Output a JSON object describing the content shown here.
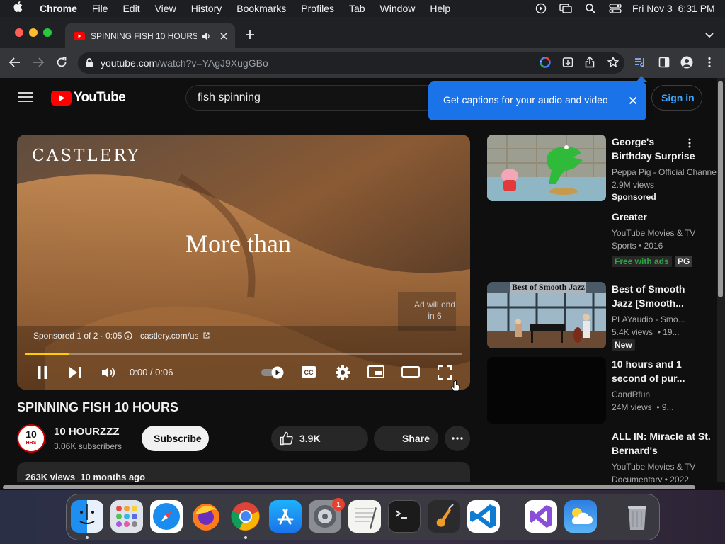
{
  "mac_menu": {
    "items": [
      "Chrome",
      "File",
      "Edit",
      "View",
      "History",
      "Bookmarks",
      "Profiles",
      "Tab",
      "Window",
      "Help"
    ],
    "datetime": "Fri Nov 3  6:31 PM"
  },
  "browser": {
    "tab_title": "SPINNING FISH 10 HOURS",
    "url_host": "youtube.com",
    "url_path": "/watch?v=YAgJ9XugGBo"
  },
  "youtube": {
    "logo_text": "YouTube",
    "search_value": "fish spinning",
    "sign_in": "Sign in",
    "caption_popup": "Get captions for your audio and video"
  },
  "player": {
    "brand": "CASTLERY",
    "overlay_text": "More than",
    "ad_end": "Ad will end in 6",
    "sponsored": "Sponsored 1 of 2 · 0:05",
    "ad_site": "castlery.com/us",
    "time": "0:00 / 0:06",
    "cc_label": "CC",
    "progress_fraction": 0.1
  },
  "video": {
    "title": "SPINNING FISH 10 HOURS",
    "channel": "10 HOURZZZ",
    "avatar_line1": "10",
    "avatar_line2": "HRS",
    "subscribers": "3.06K subscribers",
    "subscribe": "Subscribe",
    "likes": "3.9K",
    "share": "Share",
    "views_date": "263K views  10 months ago"
  },
  "recommendations": [
    {
      "title": "George's Birthday Surprise",
      "channel": "Peppa Pig - Official Channe",
      "meta": "2.9M views",
      "badge": "Sponsored"
    },
    {
      "title": "Greater",
      "channel": "YouTube Movies & TV",
      "meta": "Sports • 2016",
      "badge": "Free with ads",
      "rating": "PG"
    },
    {
      "title": "Best of Smooth Jazz [Smooth...",
      "channel": "PLAYaudio - Smo...",
      "meta": "5.4K views  • 19...",
      "badge": "New",
      "thumb_text": "Best of Smooth Jazz"
    },
    {
      "title": "10 hours and 1 second of pur...",
      "channel": "CandRfun",
      "meta": "24M views  • 9..."
    },
    {
      "title": "ALL IN: Miracle at St. Bernard's",
      "channel": "YouTube Movies & TV",
      "meta": "Documentary • 2022"
    }
  ],
  "dock": {
    "notification_count": "1",
    "apps": [
      "finder-icon",
      "launchpad-icon",
      "safari-icon",
      "firefox-icon",
      "chrome-icon",
      "app-store-icon",
      "system-settings-icon",
      "textedit-icon",
      "terminal-icon",
      "garageband-icon",
      "vscode-icon",
      "visual-studio-icon",
      "weather-icon",
      "trash-icon"
    ]
  },
  "colors": {
    "youtube_red": "#ff0000",
    "caption_blue": "#1a73e8",
    "link_blue": "#3ea6ff",
    "free_green": "#2ba640"
  }
}
